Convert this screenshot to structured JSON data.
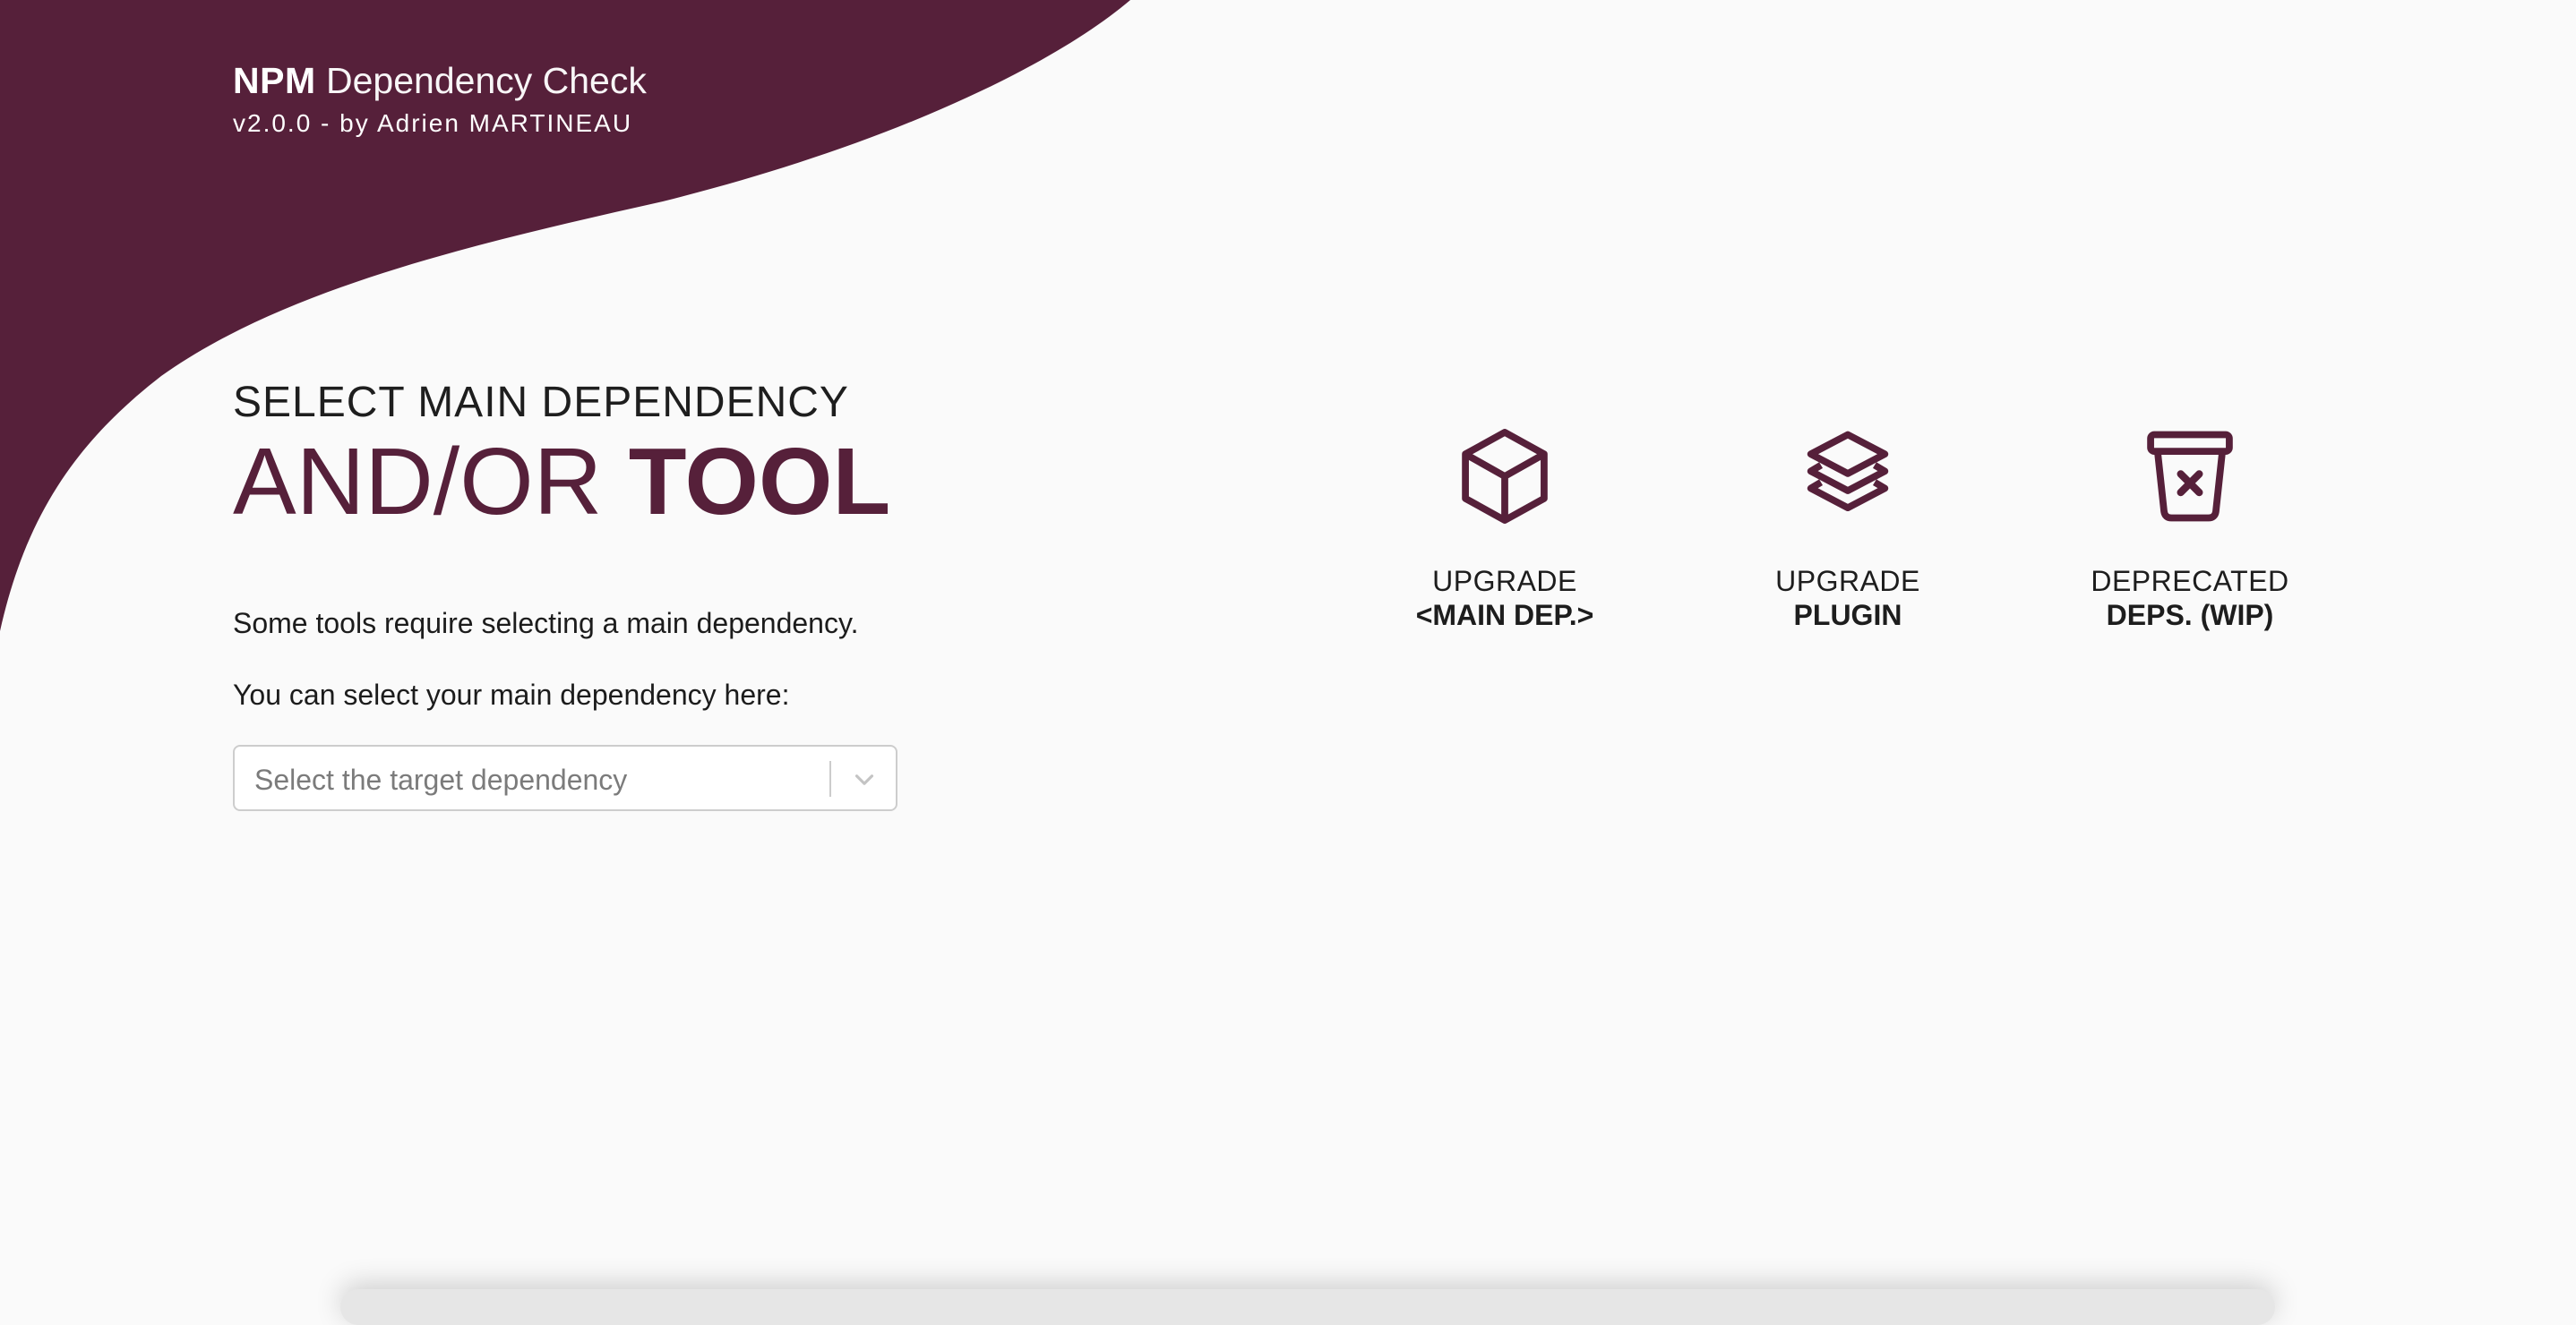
{
  "colors": {
    "brand": "#56203a",
    "background": "#fafafa",
    "text": "#1f1f1f"
  },
  "header": {
    "title_bold": "NPM",
    "title_light": "Dependency Check",
    "subtitle": "v2.0.0 - by Adrien MARTINEAU"
  },
  "main": {
    "heading_line1": "SELECT MAIN DEPENDENCY",
    "heading_line2_light": "AND/OR ",
    "heading_line2_bold": "TOOL",
    "description1": "Some tools require selecting a main dependency.",
    "description2": "You can select your main dependency here:",
    "select": {
      "placeholder": "Select the target dependency",
      "icon": "chevron-down-icon"
    }
  },
  "tools": [
    {
      "icon": "cube-icon",
      "line1": "UPGRADE",
      "line2": "<MAIN DEP.>"
    },
    {
      "icon": "layers-icon",
      "line1": "UPGRADE",
      "line2": "PLUGIN"
    },
    {
      "icon": "trash-x-icon",
      "line1": "DEPRECATED",
      "line2": "DEPS. (WIP)"
    }
  ]
}
